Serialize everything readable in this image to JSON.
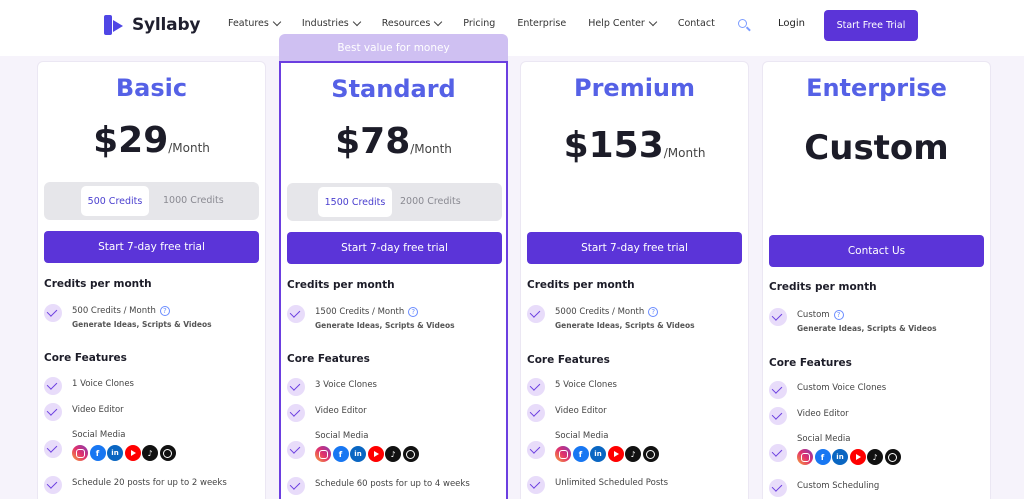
{
  "brand": {
    "name": "Syllaby"
  },
  "nav": {
    "links": [
      {
        "label": "Features",
        "dropdown": true
      },
      {
        "label": "Industries",
        "dropdown": true
      },
      {
        "label": "Resources",
        "dropdown": true
      },
      {
        "label": "Pricing",
        "dropdown": false
      },
      {
        "label": "Enterprise",
        "dropdown": false
      },
      {
        "label": "Help Center",
        "dropdown": true
      },
      {
        "label": "Contact",
        "dropdown": false
      }
    ],
    "login": "Login",
    "cta": "Start Free Trial"
  },
  "badge": "Best value for money",
  "plans": [
    {
      "name": "Basic",
      "price": "$29",
      "period": "/Month",
      "credit_options": [
        "500 Credits",
        "1000 Credits"
      ],
      "button": "Start 7-day free trial",
      "credits_title": "Credits per month",
      "credits_text": "500 Credits / Month",
      "credits_sub": "Generate Ideas, Scripts & Videos",
      "core_title": "Core Features",
      "features": [
        "1 Voice Clones",
        "Video Editor",
        "Social Media",
        "Schedule 20 posts for up to 2 weeks"
      ]
    },
    {
      "name": "Standard",
      "price": "$78",
      "period": "/Month",
      "credit_options": [
        "1500 Credits",
        "2000 Credits"
      ],
      "button": "Start 7-day free trial",
      "credits_title": "Credits per month",
      "credits_text": "1500 Credits / Month",
      "credits_sub": "Generate Ideas, Scripts & Videos",
      "core_title": "Core Features",
      "features": [
        "3 Voice Clones",
        "Video Editor",
        "Social Media",
        "Schedule 60 posts for up to 4 weeks"
      ]
    },
    {
      "name": "Premium",
      "price": "$153",
      "period": "/Month",
      "button": "Start 7-day free trial",
      "credits_title": "Credits per month",
      "credits_text": "5000 Credits / Month",
      "credits_sub": "Generate Ideas, Scripts & Videos",
      "core_title": "Core Features",
      "features": [
        "5 Voice Clones",
        "Video Editor",
        "Social Media",
        "Unlimited Scheduled Posts"
      ]
    },
    {
      "name": "Enterprise",
      "price": "Custom",
      "button": "Contact Us",
      "credits_title": "Credits per month",
      "credits_text": "Custom",
      "credits_sub": "Generate Ideas, Scripts & Videos",
      "core_title": "Core Features",
      "features": [
        "Custom Voice Clones",
        "Video Editor",
        "Social Media",
        "Custom Scheduling"
      ]
    }
  ],
  "social_icons": [
    "instagram-icon",
    "facebook-icon",
    "linkedin-icon",
    "youtube-icon",
    "tiktok-icon",
    "threads-icon"
  ],
  "social_glyphs": {
    "facebook-icon": "f",
    "linkedin-icon": "in",
    "tiktok-icon": "♪"
  },
  "colors": {
    "accent": "#5b34d8",
    "plan_name": "#5561e6",
    "badge": "#cfc0f2",
    "check_bg": "#e8dcfa"
  }
}
